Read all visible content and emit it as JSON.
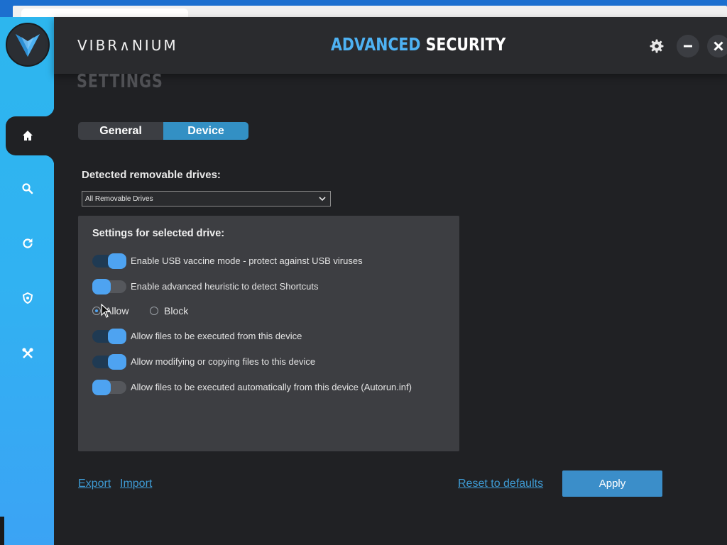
{
  "app": {
    "brand": "VIBR∧NIUM",
    "title_part1": "ADVANCED",
    "title_part2": "SECURITY"
  },
  "sidebar": {
    "items": [
      {
        "name": "home",
        "icon": "home-icon",
        "active": true
      },
      {
        "name": "search",
        "icon": "search-icon",
        "active": false
      },
      {
        "name": "update",
        "icon": "refresh-icon",
        "active": false
      },
      {
        "name": "protection",
        "icon": "shield-icon",
        "active": false
      },
      {
        "name": "tools",
        "icon": "tools-icon",
        "active": false
      }
    ]
  },
  "header": {
    "settings_icon": "gear-icon",
    "minimize_icon": "minimize-icon",
    "close_icon": "close-icon"
  },
  "page": {
    "title": "SETTINGS",
    "tabs": [
      {
        "label": "General",
        "active": false
      },
      {
        "label": "Device",
        "active": true
      }
    ],
    "detected_label": "Detected removable drives:",
    "drive_select": {
      "value": "All Removable Drives"
    },
    "panel": {
      "title": "Settings for selected drive:",
      "options": [
        {
          "label": "Enable USB vaccine mode - protect against USB viruses",
          "on": true
        },
        {
          "label": "Enable advanced heuristic to detect Shortcuts",
          "on": false
        }
      ],
      "radios": [
        {
          "label": "Allow",
          "checked": true
        },
        {
          "label": "Block",
          "checked": false
        }
      ],
      "permissions": [
        {
          "label": "Allow files to be executed from this device",
          "on": true
        },
        {
          "label": "Allow modifying or copying files to this device",
          "on": true
        },
        {
          "label": "Allow files to be executed automatically from this device (Autorun.inf)",
          "on": false
        }
      ]
    },
    "footer": {
      "export": "Export",
      "import": "Import",
      "reset": "Reset to defaults",
      "apply": "Apply"
    }
  },
  "colors": {
    "accent": "#4eb2f3",
    "sidebar": "#2db6ee",
    "background": "#202124",
    "panel": "#3d3e42",
    "apply_button": "#3b8ec9"
  }
}
